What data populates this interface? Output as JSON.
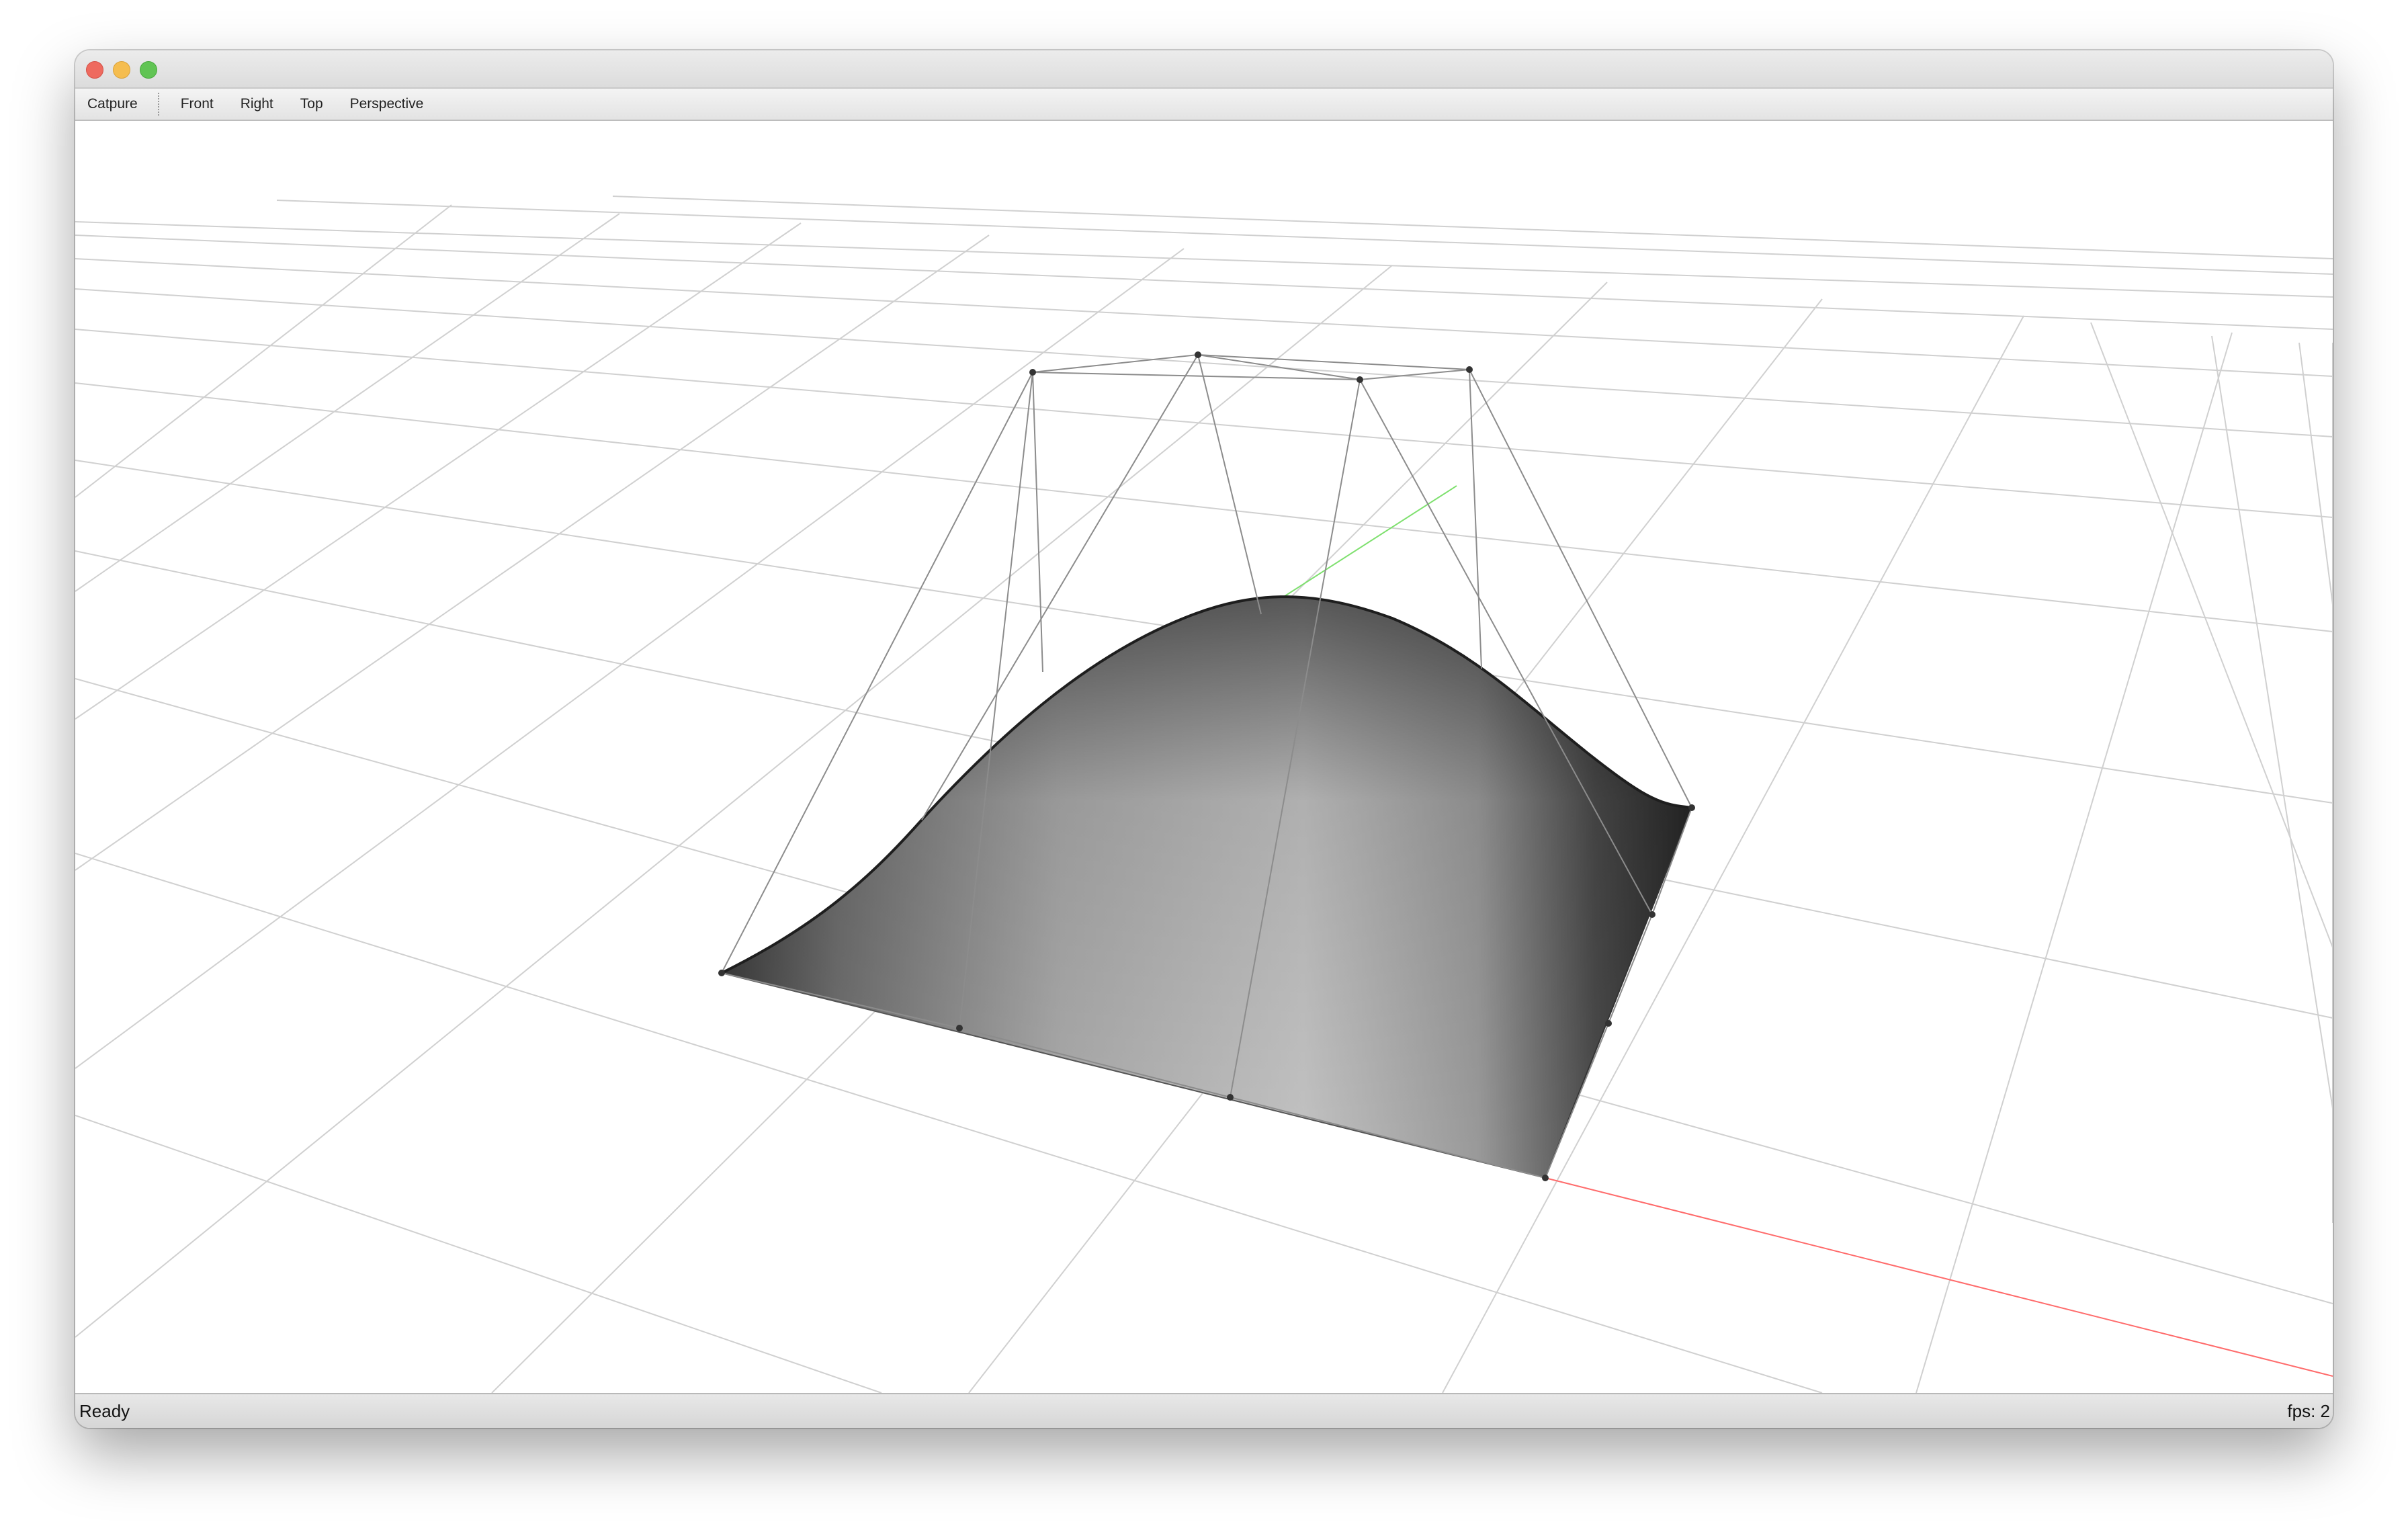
{
  "toolbar": {
    "capture_label": "Catpure",
    "front_label": "Front",
    "right_label": "Right",
    "top_label": "Top",
    "perspective_label": "Perspective"
  },
  "status": {
    "message": "Ready",
    "fps": "fps: 2"
  },
  "colors": {
    "x_axis": "#ff6b6b",
    "y_axis": "#7ee06e",
    "grid": "#cfcfcf",
    "surface_dark": "#2a2a2a",
    "surface_light": "#c4c4c4",
    "control_net": "#8c8c8c"
  }
}
